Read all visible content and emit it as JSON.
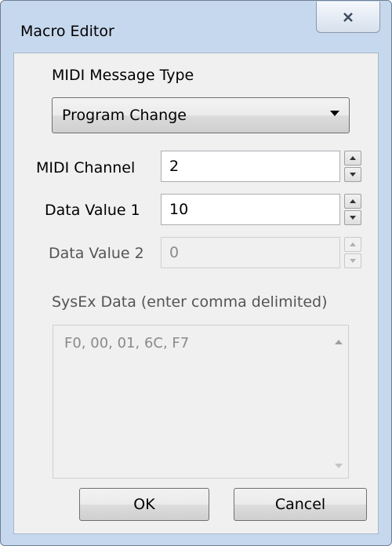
{
  "window": {
    "title": "Macro Editor",
    "close_glyph": "✕"
  },
  "message_type": {
    "label": "MIDI Message Type",
    "selected": "Program Change"
  },
  "midi_channel": {
    "label": "MIDI Channel",
    "value": "2"
  },
  "data_value_1": {
    "label": "Data Value 1",
    "value": "10"
  },
  "data_value_2": {
    "label": "Data Value 2",
    "value": "0",
    "disabled": true
  },
  "sysex": {
    "label": "SysEx Data (enter comma delimited)",
    "value": "F0, 00, 01, 6C, F7"
  },
  "buttons": {
    "ok": "OK",
    "cancel": "Cancel"
  },
  "colors": {
    "frame": "#c6d8ed",
    "client": "#f0f0f0"
  }
}
